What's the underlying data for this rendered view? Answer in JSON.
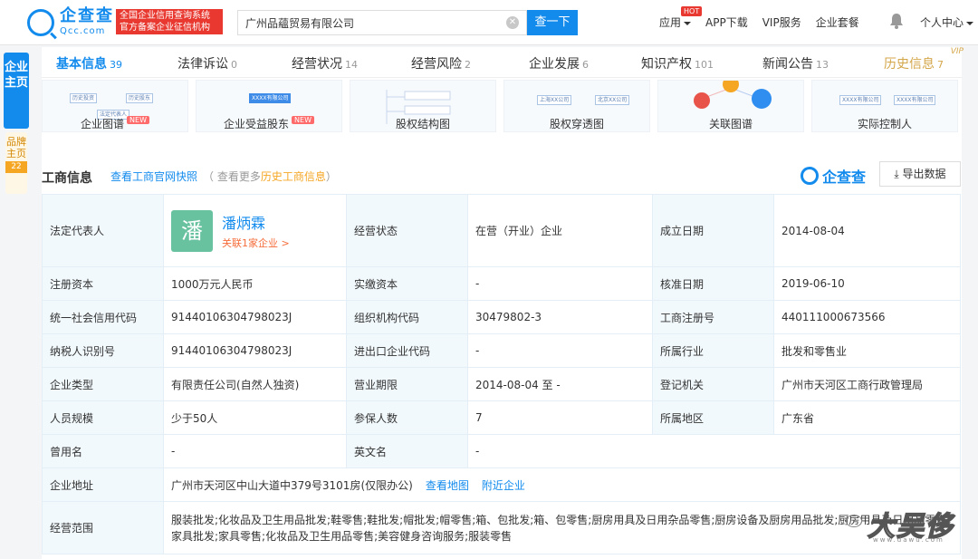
{
  "header": {
    "logo_cn": "企查查",
    "logo_en": "Qcc.com",
    "slogan_line1": "全国企业信用查询系统",
    "slogan_line2": "官方备案企业征信机构",
    "search_value": "广州品蘊贸易有限公司",
    "search_button": "查一下",
    "nav": {
      "app": "应用",
      "hot": "HOT",
      "download": "APP下载",
      "vip": "VIP服务",
      "package": "企业套餐",
      "user": "个人中心"
    }
  },
  "side_tabs": {
    "main": "企业主页",
    "brand": "品牌主页",
    "brand_count": "22"
  },
  "tabs": [
    {
      "label": "基本信息",
      "count": "39"
    },
    {
      "label": "法律诉讼",
      "count": "0"
    },
    {
      "label": "经营状况",
      "count": "14"
    },
    {
      "label": "经营风险",
      "count": "2"
    },
    {
      "label": "企业发展",
      "count": "6"
    },
    {
      "label": "知识产权",
      "count": "101"
    },
    {
      "label": "新闻公告",
      "count": "13"
    },
    {
      "label": "历史信息",
      "count": "7",
      "tag": "VIP"
    }
  ],
  "graphs": [
    {
      "label": "企业图谱",
      "badge": "NEW"
    },
    {
      "label": "企业受益股东",
      "badge": "NEW"
    },
    {
      "label": "股权结构图",
      "badge": ""
    },
    {
      "label": "股权穿透图",
      "badge": ""
    },
    {
      "label": "关联图谱",
      "badge": ""
    },
    {
      "label": "实际控制人",
      "badge": ""
    }
  ],
  "graph_thumbs": {
    "node_a": "历史投资",
    "node_b": "历史股东",
    "node_c": "法定代表人",
    "node_d": "XXXX有限公司",
    "node_e": "上海XX公司",
    "node_f": "北京XX公司",
    "node_g": "XXXX有限公司",
    "node_h": "XXXX有限公司"
  },
  "section": {
    "title": "工商信息",
    "snapshot_link": "查看工商官网快照",
    "history_prefix": "（ 查看更多",
    "history_link": "历史工商信息",
    "history_suffix": "）",
    "brand": "企查查",
    "export": "导出数据"
  },
  "info": {
    "legal_rep_key": "法定代表人",
    "legal_rep_avatar": "潘",
    "legal_rep_name": "潘炳霖",
    "legal_rep_link": "关联1家企业 >",
    "status_key": "经营状态",
    "status_val": "在营（开业）企业",
    "founded_key": "成立日期",
    "founded_val": "2014-08-04",
    "capital_key": "注册资本",
    "capital_val": "1000万元人民币",
    "paid_key": "实缴资本",
    "paid_val": "-",
    "approved_key": "核准日期",
    "approved_val": "2019-06-10",
    "credit_key": "统一社会信用代码",
    "credit_val": "91440106304798023J",
    "org_key": "组织机构代码",
    "org_val": "30479802-3",
    "reg_key": "工商注册号",
    "reg_val": "440111000673566",
    "tax_key": "纳税人识别号",
    "tax_val": "91440106304798023J",
    "impexp_key": "进出口企业代码",
    "impexp_val": "-",
    "industry_key": "所属行业",
    "industry_val": "批发和零售业",
    "type_key": "企业类型",
    "type_val": "有限责任公司(自然人独资)",
    "term_key": "营业期限",
    "term_val": "2014-08-04 至 -",
    "authority_key": "登记机关",
    "authority_val": "广州市天河区工商行政管理局",
    "staff_key": "人员规模",
    "staff_val": "少于50人",
    "insured_key": "参保人数",
    "insured_val": "7",
    "region_key": "所属地区",
    "region_val": "广东省",
    "former_key": "曾用名",
    "former_val": "-",
    "english_key": "英文名",
    "english_val": "-",
    "address_key": "企业地址",
    "address_val": "广州市天河区中山大道中379号3101房(仅限办公)",
    "map_link": "查看地图",
    "nearby_link": "附近企业",
    "scope_key": "经营范围",
    "scope_val": "服装批发;化妆品及卫生用品批发;鞋零售;鞋批发;帽批发;帽零售;箱、包批发;箱、包零售;厨房用具及日用杂品零售;厨房设备及厨房用品批发;厨房用具及日用品零售;家具批发;家具零售;化妆品及卫生用品零售;美容健身咨询服务;服装零售"
  },
  "watermark": {
    "text": "大吴侈",
    "sub": "www.dawu.com"
  },
  "colors": {
    "accent": "#128bed",
    "red": "#e8382f",
    "gold": "#d4a64a",
    "key_bg": "#f2f9fc"
  }
}
